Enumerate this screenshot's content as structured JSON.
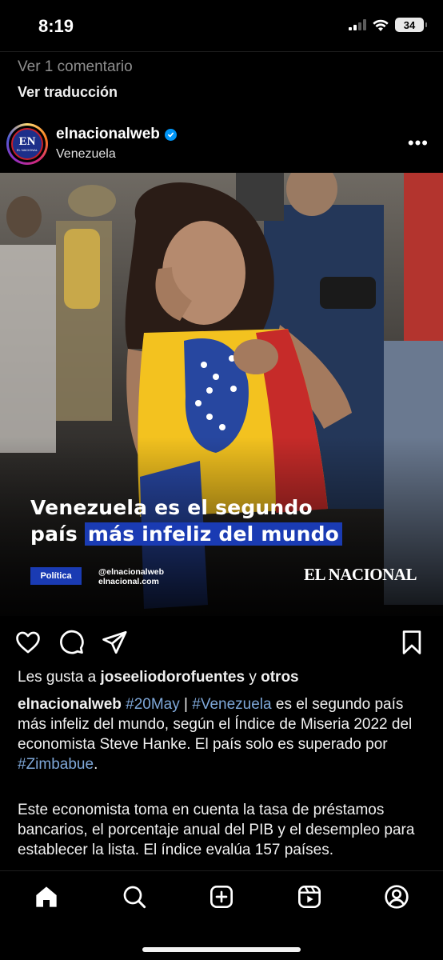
{
  "status_bar": {
    "time": "8:19",
    "battery": "34"
  },
  "comments": {
    "view_comments": "Ver 1 comentario",
    "see_translation": "Ver traducción"
  },
  "post": {
    "username": "elnacionalweb",
    "location": "Venezuela",
    "avatar_text": "EN",
    "avatar_subtext": "EL NACIONAL",
    "image": {
      "headline_line1": "Venezuela es el segundo",
      "headline_line2_plain": "país ",
      "headline_line2_highlight": "más infeliz del mundo",
      "category": "Política",
      "handle": "@elnacionalweb",
      "website": "elnacional.com",
      "brand": "EL NACIONAL"
    },
    "likes": {
      "prefix": "Les gusta a ",
      "user": "joseeliodorofuentes",
      "middle": " y ",
      "others": "otros"
    },
    "caption": {
      "username": "elnacionalweb",
      "tag1": "#20May",
      "sep": " | ",
      "tag2": "#Venezuela",
      "text1": " es el segundo país más infeliz del mundo, según el Índice de Miseria 2022 del economista Steve Hanke. El país solo es superado por ",
      "tag3": "#Zimbabue",
      "text2": ".",
      "paragraph2": "Este economista toma en cuenta la tasa de préstamos bancarios, el porcentaje anual del PIB y el desempleo para establecer la lista. El índice evalúa 157 países."
    }
  },
  "icons": {
    "like": "heart-icon",
    "comment": "comment-icon",
    "share": "send-icon",
    "save": "bookmark-icon",
    "home": "home-icon",
    "search": "search-icon",
    "create": "plus-square-icon",
    "reels": "reels-icon",
    "profile": "profile-icon"
  },
  "colors": {
    "background": "#000000",
    "hashtag": "#7ea7d8",
    "verified": "#0095f6",
    "highlight": "#1a3bb3"
  }
}
